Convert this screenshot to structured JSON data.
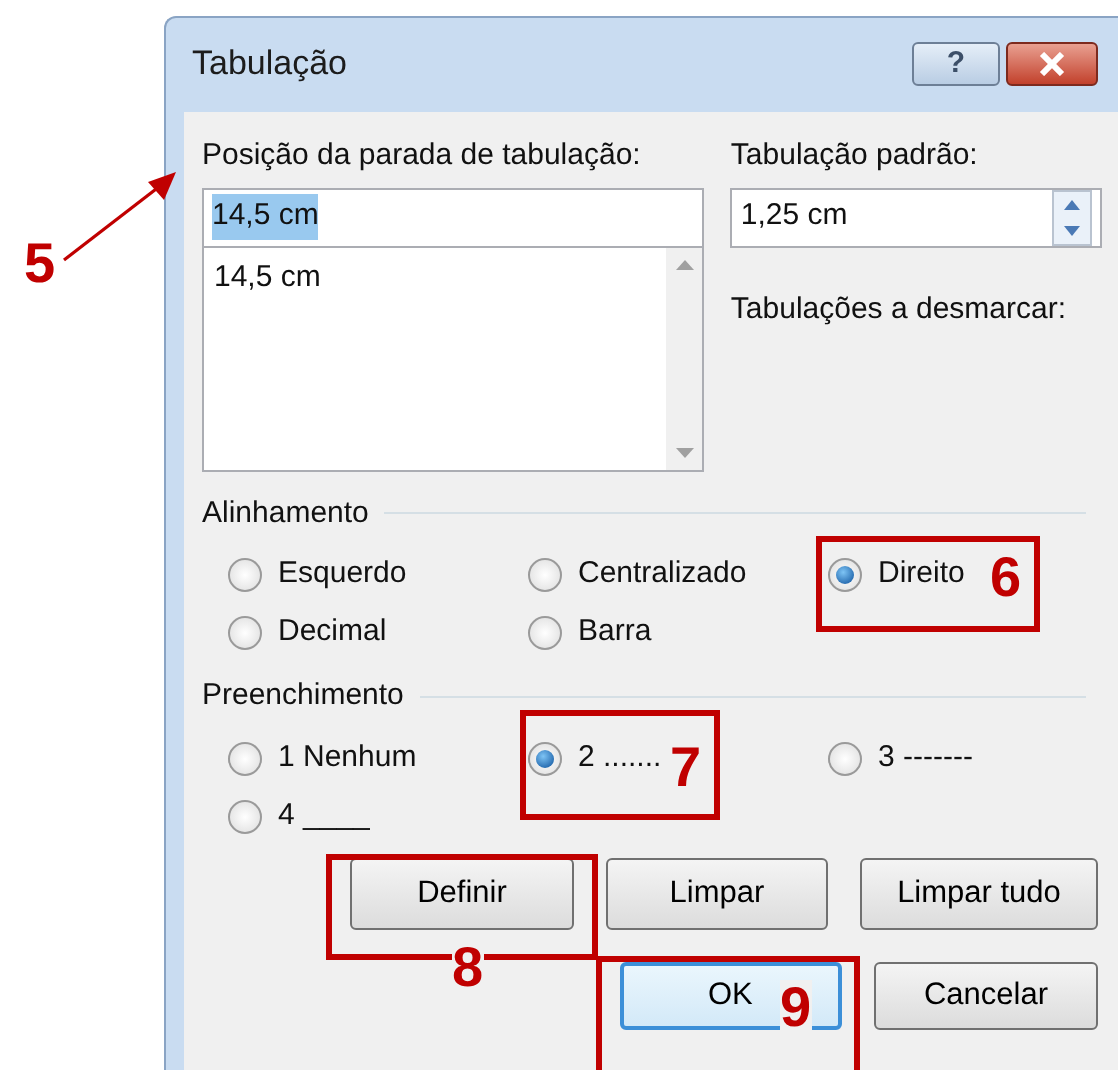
{
  "window": {
    "title": "Tabulação",
    "buttons": [
      {
        "kind": "help",
        "label": "?"
      },
      {
        "kind": "close"
      }
    ]
  },
  "tab_stop_position": {
    "label": "Posição da parada de tabulação:",
    "value": "14,5 cm",
    "value_selected": true,
    "list": [
      "14,5 cm"
    ]
  },
  "default_tabs": {
    "label": "Tabulação padrão:",
    "value": "1,25 cm"
  },
  "tabs_to_clear": {
    "label": "Tabulações a desmarcar:"
  },
  "alignment": {
    "label": "Alinhamento",
    "options": [
      {
        "label": "Esquerdo",
        "selected": false
      },
      {
        "label": "Centralizado",
        "selected": false
      },
      {
        "label": "Direito",
        "selected": true
      },
      {
        "label": "Decimal",
        "selected": false
      },
      {
        "label": "Barra",
        "selected": false
      }
    ]
  },
  "leader": {
    "label": "Preenchimento",
    "options": [
      {
        "label": "1 Nenhum",
        "selected": false
      },
      {
        "label": "2 .......",
        "selected": true
      },
      {
        "label": "3 -------",
        "selected": false
      },
      {
        "label": "4 ____",
        "selected": false
      }
    ]
  },
  "buttons": [
    {
      "label": "Definir",
      "default": false
    },
    {
      "label": "Limpar",
      "default": false
    },
    {
      "label": "Limpar tudo",
      "default": false
    },
    {
      "label": "OK",
      "default": true
    },
    {
      "label": "Cancelar",
      "default": false
    }
  ],
  "callouts": [
    {
      "label": "5",
      "kind": "arrow"
    },
    {
      "label": "6",
      "kind": "box"
    },
    {
      "label": "7",
      "kind": "box"
    },
    {
      "label": "8",
      "kind": "box"
    },
    {
      "label": "9",
      "kind": "box"
    }
  ]
}
